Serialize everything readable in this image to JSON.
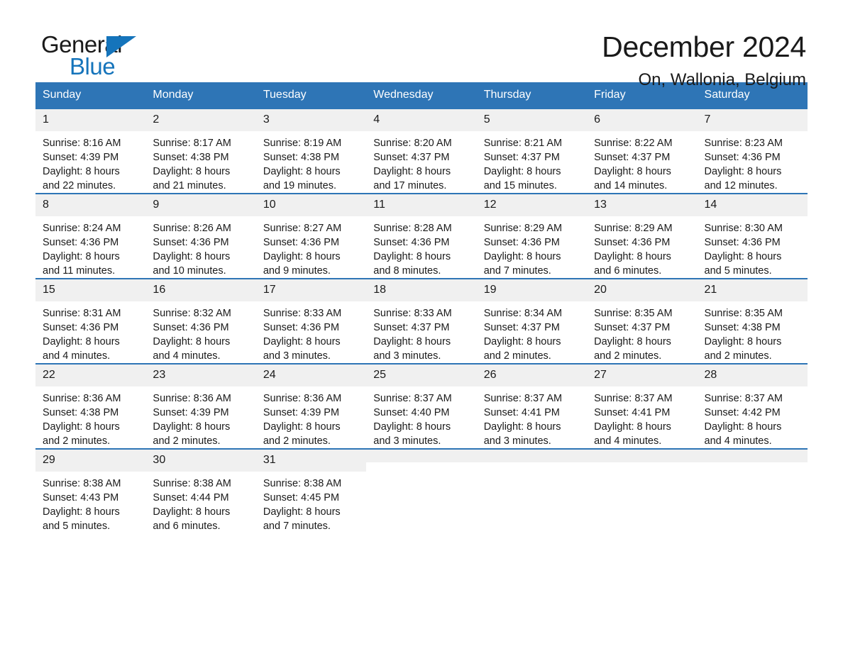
{
  "brand": {
    "name_part1": "General",
    "name_part2": "Blue",
    "triangle_icon": "brand-triangle-icon",
    "accent_color": "#1574bb"
  },
  "header": {
    "title": "December 2024",
    "subtitle": "On, Wallonia, Belgium"
  },
  "colors": {
    "header_blue": "#2e75b6",
    "daynum_band": "#f0f0f0",
    "text": "#1a1a1a"
  },
  "weekday_headers": [
    "Sunday",
    "Monday",
    "Tuesday",
    "Wednesday",
    "Thursday",
    "Friday",
    "Saturday"
  ],
  "weeks": [
    [
      {
        "day": "1",
        "sunrise": "Sunrise: 8:16 AM",
        "sunset": "Sunset: 4:39 PM",
        "daylight1": "Daylight: 8 hours",
        "daylight2": "and 22 minutes."
      },
      {
        "day": "2",
        "sunrise": "Sunrise: 8:17 AM",
        "sunset": "Sunset: 4:38 PM",
        "daylight1": "Daylight: 8 hours",
        "daylight2": "and 21 minutes."
      },
      {
        "day": "3",
        "sunrise": "Sunrise: 8:19 AM",
        "sunset": "Sunset: 4:38 PM",
        "daylight1": "Daylight: 8 hours",
        "daylight2": "and 19 minutes."
      },
      {
        "day": "4",
        "sunrise": "Sunrise: 8:20 AM",
        "sunset": "Sunset: 4:37 PM",
        "daylight1": "Daylight: 8 hours",
        "daylight2": "and 17 minutes."
      },
      {
        "day": "5",
        "sunrise": "Sunrise: 8:21 AM",
        "sunset": "Sunset: 4:37 PM",
        "daylight1": "Daylight: 8 hours",
        "daylight2": "and 15 minutes."
      },
      {
        "day": "6",
        "sunrise": "Sunrise: 8:22 AM",
        "sunset": "Sunset: 4:37 PM",
        "daylight1": "Daylight: 8 hours",
        "daylight2": "and 14 minutes."
      },
      {
        "day": "7",
        "sunrise": "Sunrise: 8:23 AM",
        "sunset": "Sunset: 4:36 PM",
        "daylight1": "Daylight: 8 hours",
        "daylight2": "and 12 minutes."
      }
    ],
    [
      {
        "day": "8",
        "sunrise": "Sunrise: 8:24 AM",
        "sunset": "Sunset: 4:36 PM",
        "daylight1": "Daylight: 8 hours",
        "daylight2": "and 11 minutes."
      },
      {
        "day": "9",
        "sunrise": "Sunrise: 8:26 AM",
        "sunset": "Sunset: 4:36 PM",
        "daylight1": "Daylight: 8 hours",
        "daylight2": "and 10 minutes."
      },
      {
        "day": "10",
        "sunrise": "Sunrise: 8:27 AM",
        "sunset": "Sunset: 4:36 PM",
        "daylight1": "Daylight: 8 hours",
        "daylight2": "and 9 minutes."
      },
      {
        "day": "11",
        "sunrise": "Sunrise: 8:28 AM",
        "sunset": "Sunset: 4:36 PM",
        "daylight1": "Daylight: 8 hours",
        "daylight2": "and 8 minutes."
      },
      {
        "day": "12",
        "sunrise": "Sunrise: 8:29 AM",
        "sunset": "Sunset: 4:36 PM",
        "daylight1": "Daylight: 8 hours",
        "daylight2": "and 7 minutes."
      },
      {
        "day": "13",
        "sunrise": "Sunrise: 8:29 AM",
        "sunset": "Sunset: 4:36 PM",
        "daylight1": "Daylight: 8 hours",
        "daylight2": "and 6 minutes."
      },
      {
        "day": "14",
        "sunrise": "Sunrise: 8:30 AM",
        "sunset": "Sunset: 4:36 PM",
        "daylight1": "Daylight: 8 hours",
        "daylight2": "and 5 minutes."
      }
    ],
    [
      {
        "day": "15",
        "sunrise": "Sunrise: 8:31 AM",
        "sunset": "Sunset: 4:36 PM",
        "daylight1": "Daylight: 8 hours",
        "daylight2": "and 4 minutes."
      },
      {
        "day": "16",
        "sunrise": "Sunrise: 8:32 AM",
        "sunset": "Sunset: 4:36 PM",
        "daylight1": "Daylight: 8 hours",
        "daylight2": "and 4 minutes."
      },
      {
        "day": "17",
        "sunrise": "Sunrise: 8:33 AM",
        "sunset": "Sunset: 4:36 PM",
        "daylight1": "Daylight: 8 hours",
        "daylight2": "and 3 minutes."
      },
      {
        "day": "18",
        "sunrise": "Sunrise: 8:33 AM",
        "sunset": "Sunset: 4:37 PM",
        "daylight1": "Daylight: 8 hours",
        "daylight2": "and 3 minutes."
      },
      {
        "day": "19",
        "sunrise": "Sunrise: 8:34 AM",
        "sunset": "Sunset: 4:37 PM",
        "daylight1": "Daylight: 8 hours",
        "daylight2": "and 2 minutes."
      },
      {
        "day": "20",
        "sunrise": "Sunrise: 8:35 AM",
        "sunset": "Sunset: 4:37 PM",
        "daylight1": "Daylight: 8 hours",
        "daylight2": "and 2 minutes."
      },
      {
        "day": "21",
        "sunrise": "Sunrise: 8:35 AM",
        "sunset": "Sunset: 4:38 PM",
        "daylight1": "Daylight: 8 hours",
        "daylight2": "and 2 minutes."
      }
    ],
    [
      {
        "day": "22",
        "sunrise": "Sunrise: 8:36 AM",
        "sunset": "Sunset: 4:38 PM",
        "daylight1": "Daylight: 8 hours",
        "daylight2": "and 2 minutes."
      },
      {
        "day": "23",
        "sunrise": "Sunrise: 8:36 AM",
        "sunset": "Sunset: 4:39 PM",
        "daylight1": "Daylight: 8 hours",
        "daylight2": "and 2 minutes."
      },
      {
        "day": "24",
        "sunrise": "Sunrise: 8:36 AM",
        "sunset": "Sunset: 4:39 PM",
        "daylight1": "Daylight: 8 hours",
        "daylight2": "and 2 minutes."
      },
      {
        "day": "25",
        "sunrise": "Sunrise: 8:37 AM",
        "sunset": "Sunset: 4:40 PM",
        "daylight1": "Daylight: 8 hours",
        "daylight2": "and 3 minutes."
      },
      {
        "day": "26",
        "sunrise": "Sunrise: 8:37 AM",
        "sunset": "Sunset: 4:41 PM",
        "daylight1": "Daylight: 8 hours",
        "daylight2": "and 3 minutes."
      },
      {
        "day": "27",
        "sunrise": "Sunrise: 8:37 AM",
        "sunset": "Sunset: 4:41 PM",
        "daylight1": "Daylight: 8 hours",
        "daylight2": "and 4 minutes."
      },
      {
        "day": "28",
        "sunrise": "Sunrise: 8:37 AM",
        "sunset": "Sunset: 4:42 PM",
        "daylight1": "Daylight: 8 hours",
        "daylight2": "and 4 minutes."
      }
    ],
    [
      {
        "day": "29",
        "sunrise": "Sunrise: 8:38 AM",
        "sunset": "Sunset: 4:43 PM",
        "daylight1": "Daylight: 8 hours",
        "daylight2": "and 5 minutes."
      },
      {
        "day": "30",
        "sunrise": "Sunrise: 8:38 AM",
        "sunset": "Sunset: 4:44 PM",
        "daylight1": "Daylight: 8 hours",
        "daylight2": "and 6 minutes."
      },
      {
        "day": "31",
        "sunrise": "Sunrise: 8:38 AM",
        "sunset": "Sunset: 4:45 PM",
        "daylight1": "Daylight: 8 hours",
        "daylight2": "and 7 minutes."
      },
      {
        "day": "",
        "sunrise": "",
        "sunset": "",
        "daylight1": "",
        "daylight2": ""
      },
      {
        "day": "",
        "sunrise": "",
        "sunset": "",
        "daylight1": "",
        "daylight2": ""
      },
      {
        "day": "",
        "sunrise": "",
        "sunset": "",
        "daylight1": "",
        "daylight2": ""
      },
      {
        "day": "",
        "sunrise": "",
        "sunset": "",
        "daylight1": "",
        "daylight2": ""
      }
    ]
  ]
}
